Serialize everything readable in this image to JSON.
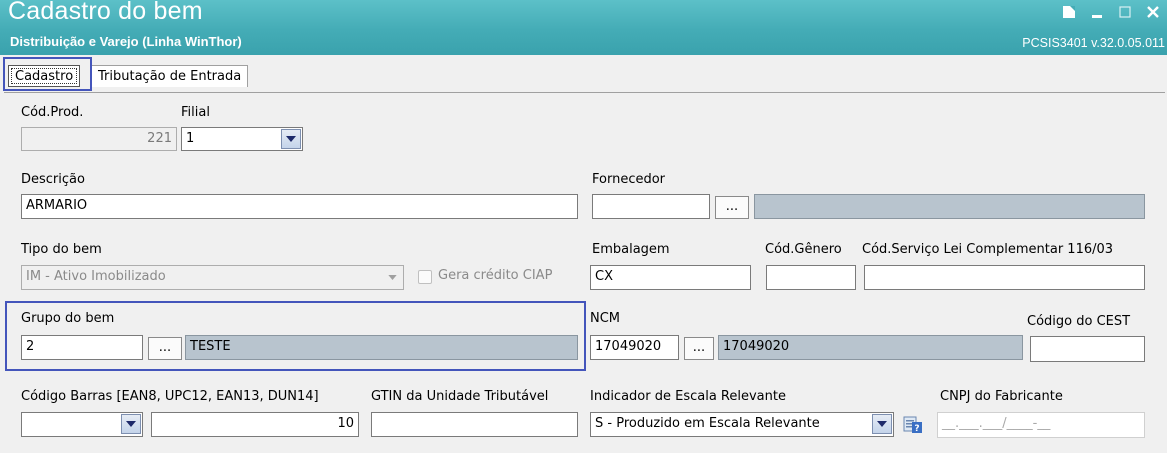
{
  "window": {
    "title": "Cadastro do bem",
    "subtitle": "Distribuição e Varejo (Linha WinThor)",
    "version": "PCSIS3401  v.32.0.05.011"
  },
  "tabs": [
    {
      "label": "Cadastro",
      "active": true
    },
    {
      "label": "Tributação de Entrada",
      "active": false
    }
  ],
  "form": {
    "cod_prod": {
      "label": "Cód.Prod.",
      "value": "221"
    },
    "filial": {
      "label": "Filial",
      "value": "1"
    },
    "descricao": {
      "label": "Descrição",
      "value": "ARMARIO"
    },
    "fornecedor": {
      "label": "Fornecedor",
      "code": "",
      "name": ""
    },
    "tipo_bem": {
      "label": "Tipo do bem",
      "value": "IM - Ativo Imobilizado"
    },
    "gera_credito": {
      "label": "Gera crédito CIAP",
      "checked": false
    },
    "embalagem": {
      "label": "Embalagem",
      "value": "CX"
    },
    "cod_genero": {
      "label": "Cód.Gênero",
      "value": ""
    },
    "cod_servico": {
      "label": "Cód.Serviço Lei Complementar 116/03",
      "value": ""
    },
    "grupo_bem": {
      "label": "Grupo do bem",
      "code": "2",
      "name": "TESTE"
    },
    "ncm": {
      "label": "NCM",
      "code": "17049020",
      "name": "17049020"
    },
    "cest": {
      "label": "Código do CEST",
      "value": ""
    },
    "codigo_barras": {
      "label": "Código Barras [EAN8, UPC12, EAN13, DUN14]",
      "type": "",
      "value": "10"
    },
    "gtin": {
      "label": "GTIN da Unidade Tributável",
      "value": ""
    },
    "indicador_escala": {
      "label": "Indicador de Escala Relevante",
      "value": "S - Produzido em Escala Relevante"
    },
    "cnpj_fabricante": {
      "label": "CNPJ do Fabricante",
      "placeholder": "__.___.___/____-__"
    },
    "lookup_button_label": "..."
  },
  "colors": {
    "header": "#44acb6",
    "highlight": "#4455bb",
    "readonly_fill": "#b8c4ce"
  }
}
